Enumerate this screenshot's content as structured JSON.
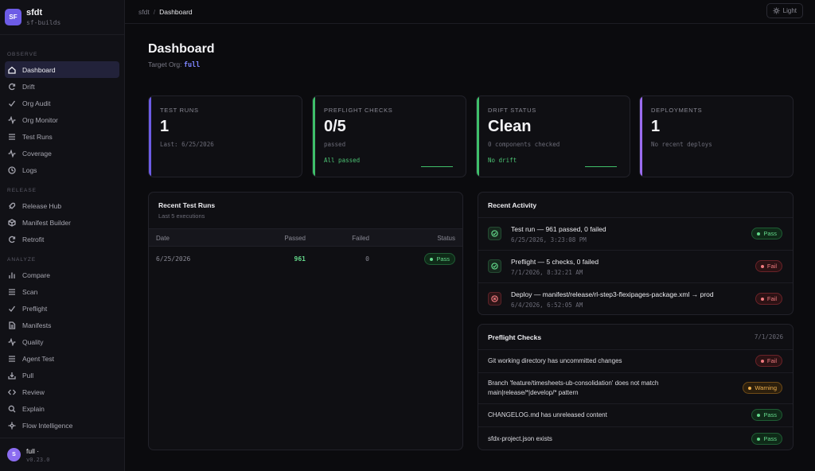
{
  "brand": {
    "logo": "SF",
    "title": "sfdt",
    "subtitle": "sf-builds"
  },
  "nav": {
    "observe_label": "OBSERVE",
    "release_label": "RELEASE",
    "analyze_label": "ANALYZE",
    "observe": [
      {
        "label": "Dashboard",
        "icon": "home-icon",
        "active": true
      },
      {
        "label": "Drift",
        "icon": "refresh-icon"
      },
      {
        "label": "Org Audit",
        "icon": "check-icon"
      },
      {
        "label": "Org Monitor",
        "icon": "activity-icon"
      },
      {
        "label": "Test Runs",
        "icon": "list-icon"
      },
      {
        "label": "Coverage",
        "icon": "activity-icon"
      },
      {
        "label": "Logs",
        "icon": "clock-icon"
      }
    ],
    "release": [
      {
        "label": "Release Hub",
        "icon": "rocket-icon"
      },
      {
        "label": "Manifest Builder",
        "icon": "box-icon"
      },
      {
        "label": "Retrofit",
        "icon": "refresh-icon"
      }
    ],
    "analyze": [
      {
        "label": "Compare",
        "icon": "bar-chart-icon"
      },
      {
        "label": "Scan",
        "icon": "list-icon"
      },
      {
        "label": "Preflight",
        "icon": "check-icon"
      },
      {
        "label": "Manifests",
        "icon": "file-icon"
      },
      {
        "label": "Quality",
        "icon": "activity-icon"
      },
      {
        "label": "Agent Test",
        "icon": "list-icon"
      },
      {
        "label": "Pull",
        "icon": "download-icon"
      },
      {
        "label": "Review",
        "icon": "code-icon"
      },
      {
        "label": "Explain",
        "icon": "search-icon"
      },
      {
        "label": "Flow Intelligence",
        "icon": "flow-icon"
      }
    ]
  },
  "footer": {
    "avatar": "S",
    "name": "full ·",
    "version": "v0.23.0"
  },
  "breadcrumb": {
    "root": "sfdt",
    "sep": "/",
    "current": "Dashboard"
  },
  "theme_button": {
    "label": "Light",
    "icon": "sun-icon"
  },
  "page": {
    "title": "Dashboard",
    "target_label": "Target Org:",
    "target_value": "full"
  },
  "cards": [
    {
      "label": "TEST RUNS",
      "value": "1",
      "sub": "Last: 6/25/2026",
      "foot": "",
      "accent": "#6d5ce6"
    },
    {
      "label": "PREFLIGHT CHECKS",
      "value": "0/5",
      "sub": "passed",
      "foot": "All passed",
      "accent": "#3fbf6a"
    },
    {
      "label": "DRIFT STATUS",
      "value": "Clean",
      "sub": "0 components checked",
      "foot": "No drift",
      "accent": "#3fbf6a"
    },
    {
      "label": "DEPLOYMENTS",
      "value": "1",
      "sub": "No recent deploys",
      "foot": "",
      "accent": "#9b6cf0"
    }
  ],
  "recent_test_runs": {
    "title": "Recent Test Runs",
    "subtitle": "Last 5 executions",
    "columns": [
      "Date",
      "Passed",
      "Failed",
      "Status"
    ],
    "rows": [
      {
        "date": "6/25/2026",
        "passed": "961",
        "failed": "0",
        "status": "Pass"
      }
    ]
  },
  "recent_activity": {
    "title": "Recent Activity",
    "items": [
      {
        "title": "Test run — 961 passed, 0 failed",
        "time": "6/25/2026, 3:23:08 PM",
        "status": "Pass",
        "kind": "pass",
        "icon": "check-circle-icon"
      },
      {
        "title": "Preflight — 5 checks, 0 failed",
        "time": "7/1/2026, 8:32:21 AM",
        "status": "Fail",
        "kind": "fail",
        "icon": "check-circle-icon"
      },
      {
        "title": "Deploy — manifest/release/rl-step3-flexipages-package.xml → prod",
        "time": "6/4/2026, 6:52:05 AM",
        "status": "Fail",
        "kind": "fail",
        "icon": "x-circle-icon"
      }
    ]
  },
  "preflight_checks": {
    "title": "Preflight Checks",
    "date": "7/1/2026",
    "items": [
      {
        "line1": "Git working directory has uncommitted changes",
        "line2": "",
        "status": "Fail",
        "kind": "fail"
      },
      {
        "line1": "Branch 'feature/timesheets-ub-consolidation' does not match",
        "line2": "main|release/*|develop/* pattern",
        "status": "Warning",
        "kind": "warn"
      },
      {
        "line1": "CHANGELOG.md has unreleased content",
        "line2": "",
        "status": "Pass",
        "kind": "pass"
      },
      {
        "line1": "sfdx-project.json exists",
        "line2": "",
        "status": "Pass",
        "kind": "pass"
      }
    ]
  }
}
